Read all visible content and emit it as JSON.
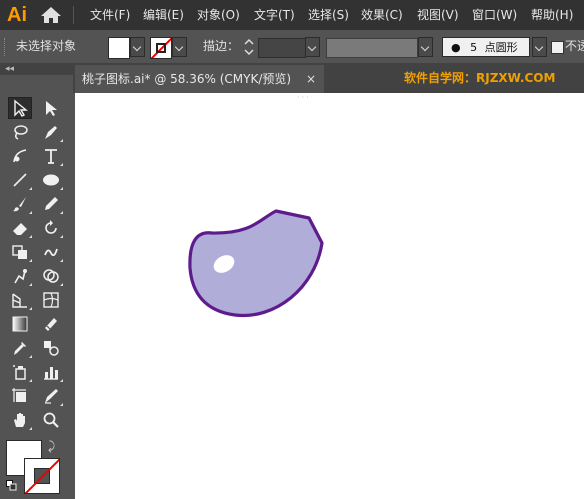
{
  "app": {
    "logo_text": "Ai",
    "menu": [
      "文件(F)",
      "编辑(E)",
      "对象(O)",
      "文字(T)",
      "选择(S)",
      "效果(C)",
      "视图(V)",
      "窗口(W)",
      "帮助(H)"
    ]
  },
  "control_bar": {
    "selection_status": "未选择对象",
    "stroke_label": "描边：",
    "brush_size": "5",
    "brush_name": "点圆形",
    "opacity_label": "不透明"
  },
  "document": {
    "tab_title": "桃子图标.ai* @ 58.36% (CMYK/预览)",
    "close_glyph": "×",
    "zoom_percent": 58.36,
    "color_mode": "CMYK",
    "watermark": "软件自学网：RJZXW.COM"
  },
  "tools_panel": {
    "collapse_glyph": "◂◂",
    "tools": [
      {
        "name": "selection-tool-icon",
        "active": true
      },
      {
        "name": "direct-selection-tool-icon"
      },
      {
        "name": "lasso-tool-icon"
      },
      {
        "name": "pen-tool-icon"
      },
      {
        "name": "curvature-tool-icon"
      },
      {
        "name": "type-tool-icon"
      },
      {
        "name": "line-segment-tool-icon"
      },
      {
        "name": "ellipse-tool-icon"
      },
      {
        "name": "paintbrush-tool-icon"
      },
      {
        "name": "pencil-tool-icon"
      },
      {
        "name": "eraser-tool-icon"
      },
      {
        "name": "rotate-tool-icon"
      },
      {
        "name": "width-tool-icon"
      },
      {
        "name": "warp-tool-icon"
      },
      {
        "name": "puppet-warp-tool-icon"
      },
      {
        "name": "shape-builder-tool-icon"
      },
      {
        "name": "perspective-grid-tool-icon"
      },
      {
        "name": "mesh-tool-icon"
      },
      {
        "name": "gradient-tool-icon"
      },
      {
        "name": "eyedropper-tool-icon"
      },
      {
        "name": "blend-tool-icon"
      },
      {
        "name": "symbol-sprayer-tool-icon"
      },
      {
        "name": "column-graph-tool-icon"
      },
      {
        "name": "artboard-tool-icon"
      },
      {
        "name": "slice-tool-icon"
      },
      {
        "name": "hand-tool-icon"
      },
      {
        "name": "zoom-tool-icon"
      }
    ]
  },
  "colors": {
    "fill": "#ffffff",
    "stroke": "none",
    "shape_fill": "#b0add8",
    "shape_stroke": "#5e1b8e",
    "highlight": "#ffffff",
    "accent_logo": "#ff9a00",
    "watermark": "#f0a000"
  }
}
